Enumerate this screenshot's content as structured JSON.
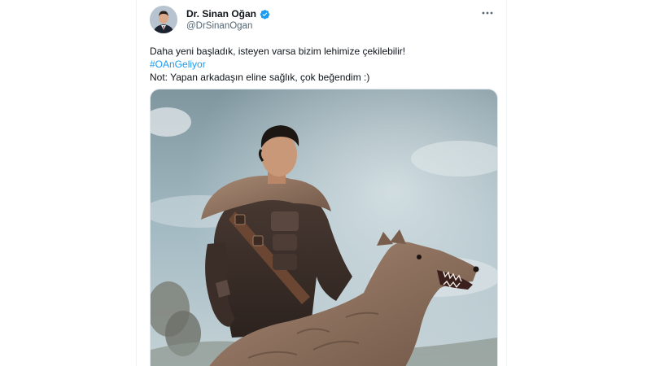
{
  "tweet": {
    "author": {
      "display_name": "Dr. Sinan Oğan",
      "handle": "@DrSinanOgan",
      "verified": true,
      "avatar": "profile-photo"
    },
    "more_icon": "more-horizontal-icon",
    "text": {
      "line1": "Daha yeni başladık, isteyen varsa bizim lehimize çekilebilir!",
      "hashtag": "#OAnGeliyor",
      "line3": "Not: Yapan arkadaşın eline sağlık, çok beğendim :)"
    },
    "media": {
      "type": "image",
      "subject": "warrior-with-wolf-illustration"
    }
  },
  "colors": {
    "text": "#0f1419",
    "secondary_text": "#536471",
    "link": "#1d9bf0",
    "verified_badge": "#1d9bf0"
  }
}
